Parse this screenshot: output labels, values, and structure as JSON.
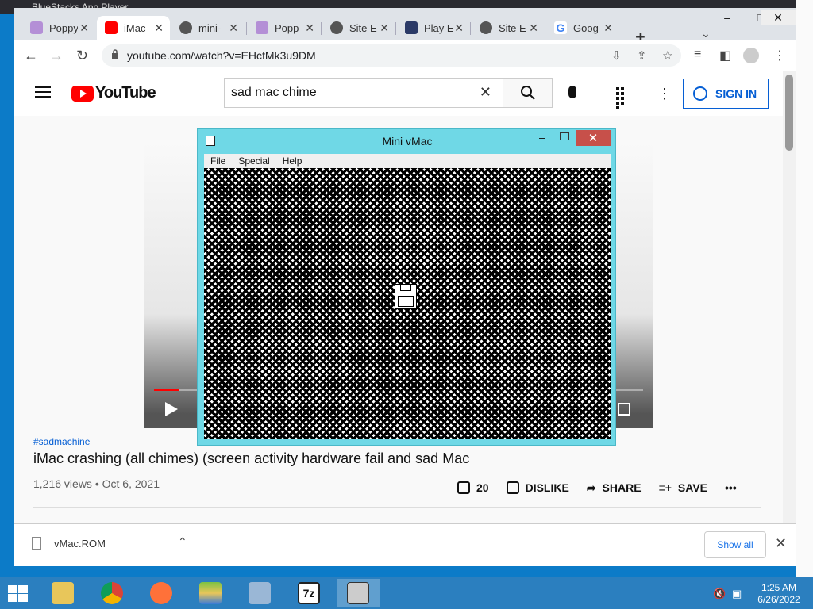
{
  "behind_window": {
    "title": "BlueStacks App Player"
  },
  "browser": {
    "tabs": [
      {
        "title": "Poppy",
        "color": "#b48fd6"
      },
      {
        "title": "iMac",
        "color": "#ff0000",
        "active": true
      },
      {
        "title": "mini-",
        "color": "#555555"
      },
      {
        "title": "Popp",
        "color": "#b48fd6"
      },
      {
        "title": "Site E",
        "color": "#555555"
      },
      {
        "title": "Play E",
        "color": "#2b3a67"
      },
      {
        "title": "Site E",
        "color": "#555555"
      },
      {
        "title": "Goog",
        "color": "#4285f4"
      }
    ],
    "address": "youtube.com/watch?v=EHcfMk3u9DM",
    "window_controls": {
      "minimize": "–",
      "maximize": "□",
      "close": "✕"
    }
  },
  "youtube": {
    "logo_text": "YouTube",
    "search_value": "sad mac chime",
    "sign_in": "SIGN IN",
    "hashtag": "#sadmachine",
    "video_title": "iMac crashing (all chimes) (screen activity hardware fail and sad Mac",
    "views": "1,216 views • Oct 6, 2021",
    "likes": "20",
    "dislike": "DISLIKE",
    "share": "SHARE",
    "save": "SAVE",
    "more": "•••"
  },
  "downloads": {
    "file": "vMac.ROM",
    "show_all": "Show all"
  },
  "vmac": {
    "title": "Mini vMac",
    "menu": [
      "File",
      "Special",
      "Help"
    ]
  },
  "taskbar": {
    "time": "1:25 AM",
    "date": "6/26/2022",
    "apps": [
      {
        "icon": "file-explorer-icon",
        "color": "#e8c65a"
      },
      {
        "icon": "chrome-icon",
        "color": "#db4437"
      },
      {
        "icon": "firefox-icon",
        "color": "#ff7139"
      },
      {
        "icon": "bluestacks-icon",
        "color": "#7cc242"
      },
      {
        "icon": "control-panel-icon",
        "color": "#9ab7d6"
      },
      {
        "icon": "7zip-icon",
        "color": "#222222"
      },
      {
        "icon": "mini-vmac-icon",
        "color": "#cccccc"
      }
    ]
  }
}
